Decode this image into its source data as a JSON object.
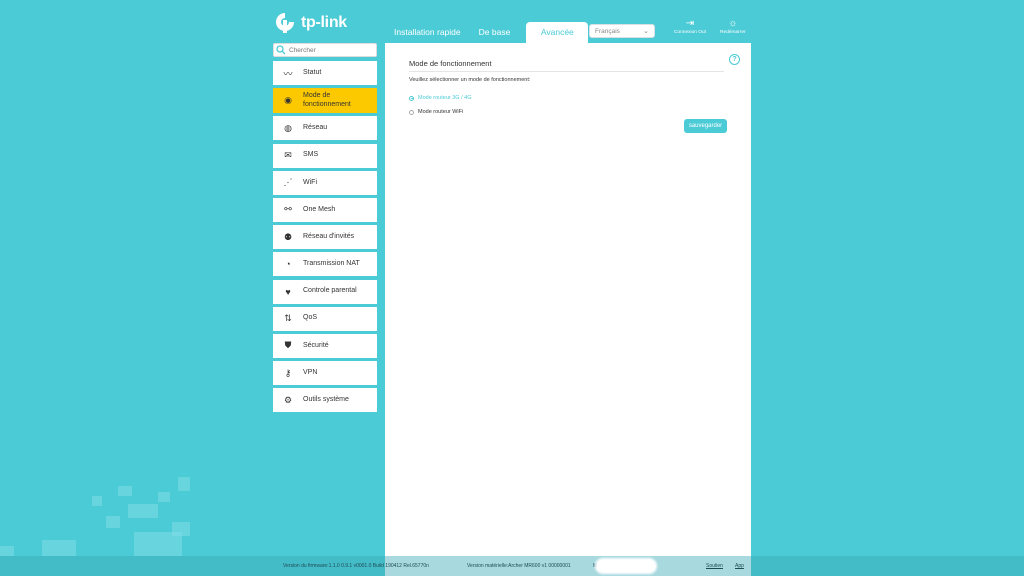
{
  "brand": {
    "logo_text": "tp-link"
  },
  "tabs": [
    {
      "label": "Installation rapide"
    },
    {
      "label": "De base"
    },
    {
      "label": "Avancée"
    }
  ],
  "language": {
    "selected": "Français"
  },
  "top_buttons": {
    "logout": "Connexion Out",
    "reboot": "Redémarrer"
  },
  "search": {
    "placeholder": "Chercher"
  },
  "sidebar": {
    "items": [
      {
        "label": "Statut",
        "icon": "pulse-icon"
      },
      {
        "label": "Mode de fonctionnement",
        "icon": "toggle-icon"
      },
      {
        "label": "Réseau",
        "icon": "globe-icon"
      },
      {
        "label": "SMS",
        "icon": "envelope-icon"
      },
      {
        "label": "WiFi",
        "icon": "wifi-icon"
      },
      {
        "label": "One Mesh",
        "icon": "mesh-icon"
      },
      {
        "label": "Réseau d'invités",
        "icon": "guests-icon"
      },
      {
        "label": "Transmission NAT",
        "icon": "nat-icon"
      },
      {
        "label": "Controle parental",
        "icon": "heart-icon"
      },
      {
        "label": "QoS",
        "icon": "arrows-icon"
      },
      {
        "label": "Sécurité",
        "icon": "shield-icon"
      },
      {
        "label": "VPN",
        "icon": "key-icon"
      },
      {
        "label": "Outils système",
        "icon": "gear-icon"
      }
    ]
  },
  "panel": {
    "title": "Mode de fonctionnement",
    "prompt": "Veuillez sélectionner un mode de fonctionnement:",
    "options": [
      {
        "label": "Mode routeur 3G / 4G",
        "selected": true
      },
      {
        "label": "Mode routeur WiFi",
        "selected": false
      }
    ],
    "save_label": "sauvegarder",
    "help": "?"
  },
  "footer": {
    "firmware": "Version du firmware:1.1.0 0.9.1 v0001.0 Build 190412 Rel.65770n",
    "hardware": "Version matérielle:Archer MR600 v1 00000001",
    "hardware_suffix": "M",
    "support": "Soutien",
    "app": "App"
  },
  "colors": {
    "accent": "#4bcbd6",
    "active_item": "#fcc900",
    "background": "#4bcbd6"
  }
}
